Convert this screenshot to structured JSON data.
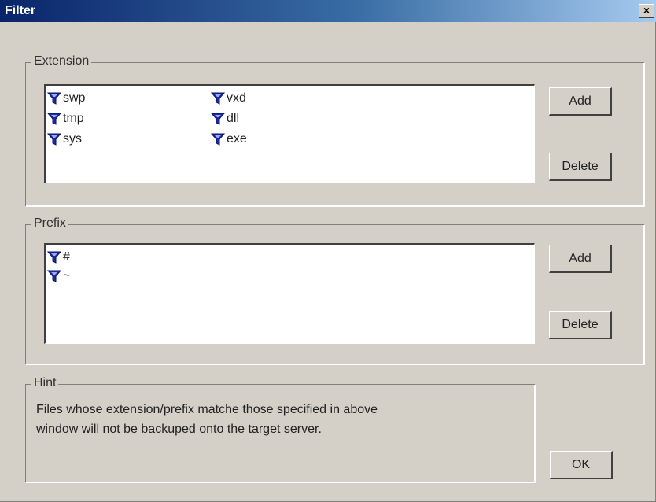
{
  "window": {
    "title": "Filter",
    "close_glyph": "×"
  },
  "extension": {
    "label": "Extension",
    "items": [
      {
        "icon": "filter-icon",
        "text": "swp"
      },
      {
        "icon": "filter-icon",
        "text": "tmp"
      },
      {
        "icon": "filter-icon",
        "text": "sys"
      },
      {
        "icon": "filter-icon",
        "text": "vxd"
      },
      {
        "icon": "filter-icon",
        "text": "dll"
      },
      {
        "icon": "filter-icon",
        "text": "exe"
      }
    ],
    "add_label": "Add",
    "delete_label": "Delete"
  },
  "prefix": {
    "label": "Prefix",
    "items": [
      {
        "icon": "filter-icon",
        "text": "#"
      },
      {
        "icon": "filter-icon",
        "text": "~"
      }
    ],
    "add_label": "Add",
    "delete_label": "Delete"
  },
  "hint": {
    "label": "Hint",
    "line1": "Files whose extension/prefix matche those specified in above",
    "line2": "window will not be backuped onto the target server."
  },
  "ok_label": "OK",
  "colors": {
    "title_start": "#0a246a",
    "title_end": "#a6caf0",
    "face": "#d4d0c8",
    "icon": "#1b2aa0"
  }
}
